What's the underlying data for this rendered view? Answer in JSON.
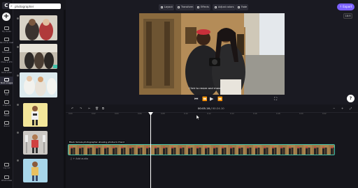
{
  "app": {
    "logo": "C",
    "new_button": "+"
  },
  "rail": [
    {
      "label": "My media",
      "icon": "folder-icon",
      "active": false
    },
    {
      "label": "Record & create",
      "icon": "camera-icon",
      "active": false
    },
    {
      "label": "Templates",
      "icon": "templates-icon",
      "active": false
    },
    {
      "label": "Music & SFX",
      "icon": "music-icon",
      "active": false
    },
    {
      "label": "Stock video",
      "icon": "film-icon",
      "active": false
    },
    {
      "label": "Stock images",
      "icon": "image-icon",
      "active": true
    },
    {
      "label": "Text",
      "icon": "text-icon",
      "active": false
    },
    {
      "label": "Graphics",
      "icon": "shapes-icon",
      "active": false
    },
    {
      "label": "Filters",
      "icon": "filter-icon",
      "active": false
    },
    {
      "label": "Brand",
      "icon": "brand-icon",
      "active": false
    },
    {
      "label": "Log out",
      "icon": "logout-icon",
      "active": false
    },
    {
      "label": "What's New",
      "icon": "gift-icon",
      "active": false
    }
  ],
  "search": {
    "value": "photographer",
    "back_icon": "<",
    "search_icon": "⌕"
  },
  "toolbar": {
    "buttons": [
      "Layout",
      "Transform",
      "Effects",
      "Adjust colors",
      "Fade"
    ],
    "export_label": "Export",
    "aspect_ratio": "16:9"
  },
  "preview": {
    "caption": "Click to resize and move"
  },
  "player": {
    "controls": [
      "⏮",
      "⏪",
      "▶",
      "⏩",
      "⛶"
    ]
  },
  "help_label": "?",
  "timeline": {
    "current_time": "00:05.16",
    "total_time": "00:24.10",
    "separator": " / ",
    "tools": [
      "↶",
      "↷",
      "✂",
      "🗑",
      "⧉"
    ],
    "zoom": [
      "−",
      "+",
      "⤢"
    ],
    "ruler_ticks": [
      "0:00",
      "0:02",
      "0:04",
      "0:06",
      "0:08",
      "0:10",
      "0:12",
      "0:14",
      "0:16",
      "0:18",
      "0:20",
      "0:22"
    ],
    "video_track_label": "Black female photographer showing photos to friend",
    "audio_label": "+ Add audio"
  },
  "colors": {
    "accent": "#7b61ff",
    "track": "#3ec0a9",
    "background": "#1a1a22"
  }
}
